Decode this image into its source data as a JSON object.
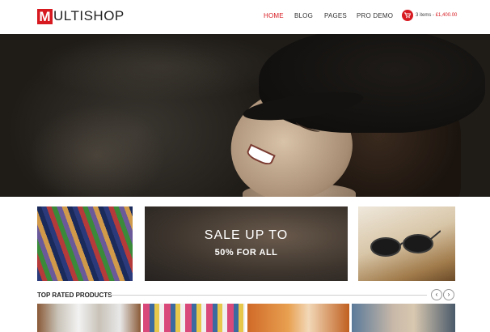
{
  "brand": {
    "logo_letter": "M",
    "logo_rest": "ULTISHOP",
    "accent": "#d71920"
  },
  "nav": {
    "home": "HOME",
    "blog": "BLOG",
    "pages": "PAGES",
    "pro_demo": "PRO DEMO"
  },
  "cart": {
    "items": "3 items",
    "separator": " - ",
    "price": "£1,400.00",
    "icon": "cart-icon"
  },
  "banners": {
    "sale_line1": "SALE UP TO",
    "sale_line2": "50% FOR ALL"
  },
  "top_rated": {
    "title": "TOP RATED PRODUCTS",
    "prev_icon": "chevron-left-icon",
    "next_icon": "chevron-right-icon",
    "prev": "‹",
    "next": "›"
  }
}
